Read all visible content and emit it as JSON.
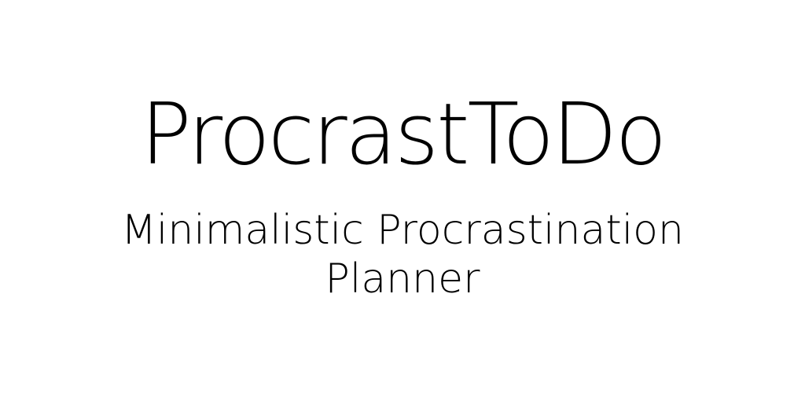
{
  "app": {
    "title": "ProcrastToDo",
    "subtitle_line1": "Minimalistic Procrastination",
    "subtitle_line2": "Planner"
  },
  "colors": {
    "background": "#ffffff",
    "text": "#000000"
  }
}
